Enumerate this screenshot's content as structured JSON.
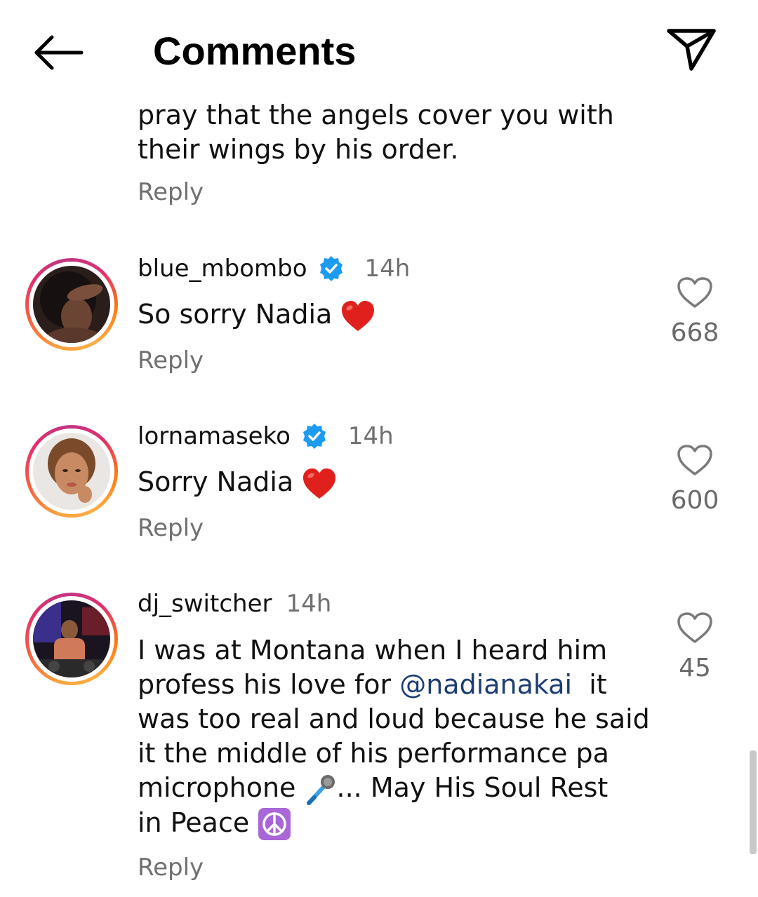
{
  "header": {
    "title": "Comments"
  },
  "partial_comment": {
    "line1": "pray that the angels cover you with",
    "line2": "their wings by his order.",
    "reply_label": "Reply"
  },
  "comments": [
    {
      "username": "blue_mbombo",
      "verified": true,
      "time": "14h",
      "text": "So sorry Nadia",
      "reply_label": "Reply",
      "likes": "668"
    },
    {
      "username": "lornamaseko",
      "verified": true,
      "time": "14h",
      "text": "Sorry Nadia",
      "reply_label": "Reply",
      "likes": "600"
    },
    {
      "username": "dj_switcher",
      "verified": false,
      "time": "14h",
      "text_line1": "I was at Montana when I heard him",
      "text_line2_pre": "profess his love for ",
      "mention": "@nadianakai",
      "text_line2_post": "  it",
      "text_line3": "was too real and loud because he said",
      "text_line4": "it the middle of his performance pa",
      "text_line5_pre": "microphone ",
      "text_line5_post": "... May His Soul Rest",
      "text_line6": "in Peace",
      "reply_label": "Reply",
      "likes": "45"
    }
  ],
  "icons": {
    "back": "arrow-left-icon",
    "share": "send-icon",
    "verified": "verified-badge-icon",
    "like": "heart-outline-icon",
    "heart_emoji": "red-heart-emoji",
    "microphone_emoji": "microphone-emoji",
    "peace_emoji": "peace-symbol-emoji"
  },
  "colors": {
    "verified_blue": "#1d9bf0",
    "mention": "#1c3d73",
    "secondary_text": "#707070",
    "heart_red": "#e0201c",
    "peace_purple": "#9b59d0"
  }
}
